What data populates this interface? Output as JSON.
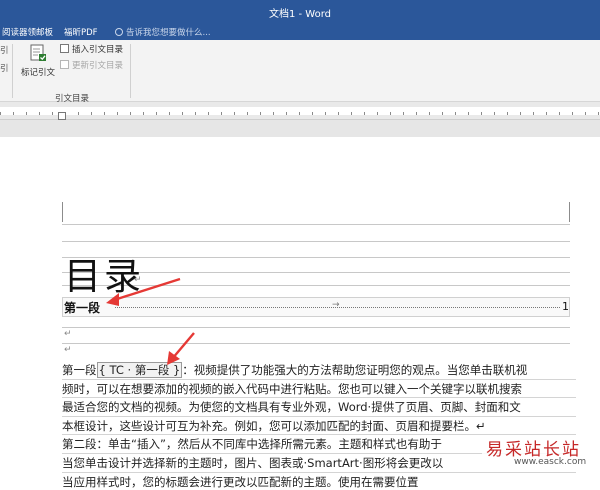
{
  "window": {
    "title": "文档1 - Word"
  },
  "ribbon_tabs": {
    "items": [
      "阅读器领邮板",
      "福昕PDF"
    ],
    "tell_me": "告诉我您想要做什么..."
  },
  "ribbon": {
    "left_fragments": [
      "引",
      "引"
    ],
    "mark_citation_label": "标记引文",
    "insert_toa_label": "插入引文目录",
    "update_toa_label": "更新引文目录",
    "group_label": "引文目录"
  },
  "document": {
    "heading": "目录",
    "toc_entry": {
      "text": "第一段",
      "tab_marker": "→",
      "page": "1"
    },
    "paragraph_mark": "↵",
    "body_lines": [
      {
        "prefix": "第一段",
        "field_code": "{ TC · 第一段 }",
        "rest": "：视频提供了功能强大的方法帮助您证明您的观点。当您单击联机视"
      },
      {
        "text": "频时，可以在想要添加的视频的嵌入代码中进行粘贴。您也可以键入一个关键字以联机搜索"
      },
      {
        "text": "最适合您的文档的视频。为使您的文档具有专业外观，Word·提供了页眉、页脚、封面和文"
      },
      {
        "text": "本框设计，这些设计可互为补充。例如，您可以添加匹配的封面、页眉和提要栏。↵"
      },
      {
        "text": "第二段：单击“插入”，然后从不同库中选择所需元素。主题和样式也有助于"
      },
      {
        "text": "当您单击设计并选择新的主题时，图片、图表或·SmartArt·图形将会更改以"
      },
      {
        "text": "当应用样式时，您的标题会进行更改以匹配新的主题。使用在需要位置"
      }
    ]
  },
  "watermark": {
    "text": "易采站长站",
    "url": "www.easck.com"
  },
  "colors": {
    "title_bar": "#2b579a",
    "arrow": "#e53935",
    "watermark": "#c62828"
  }
}
